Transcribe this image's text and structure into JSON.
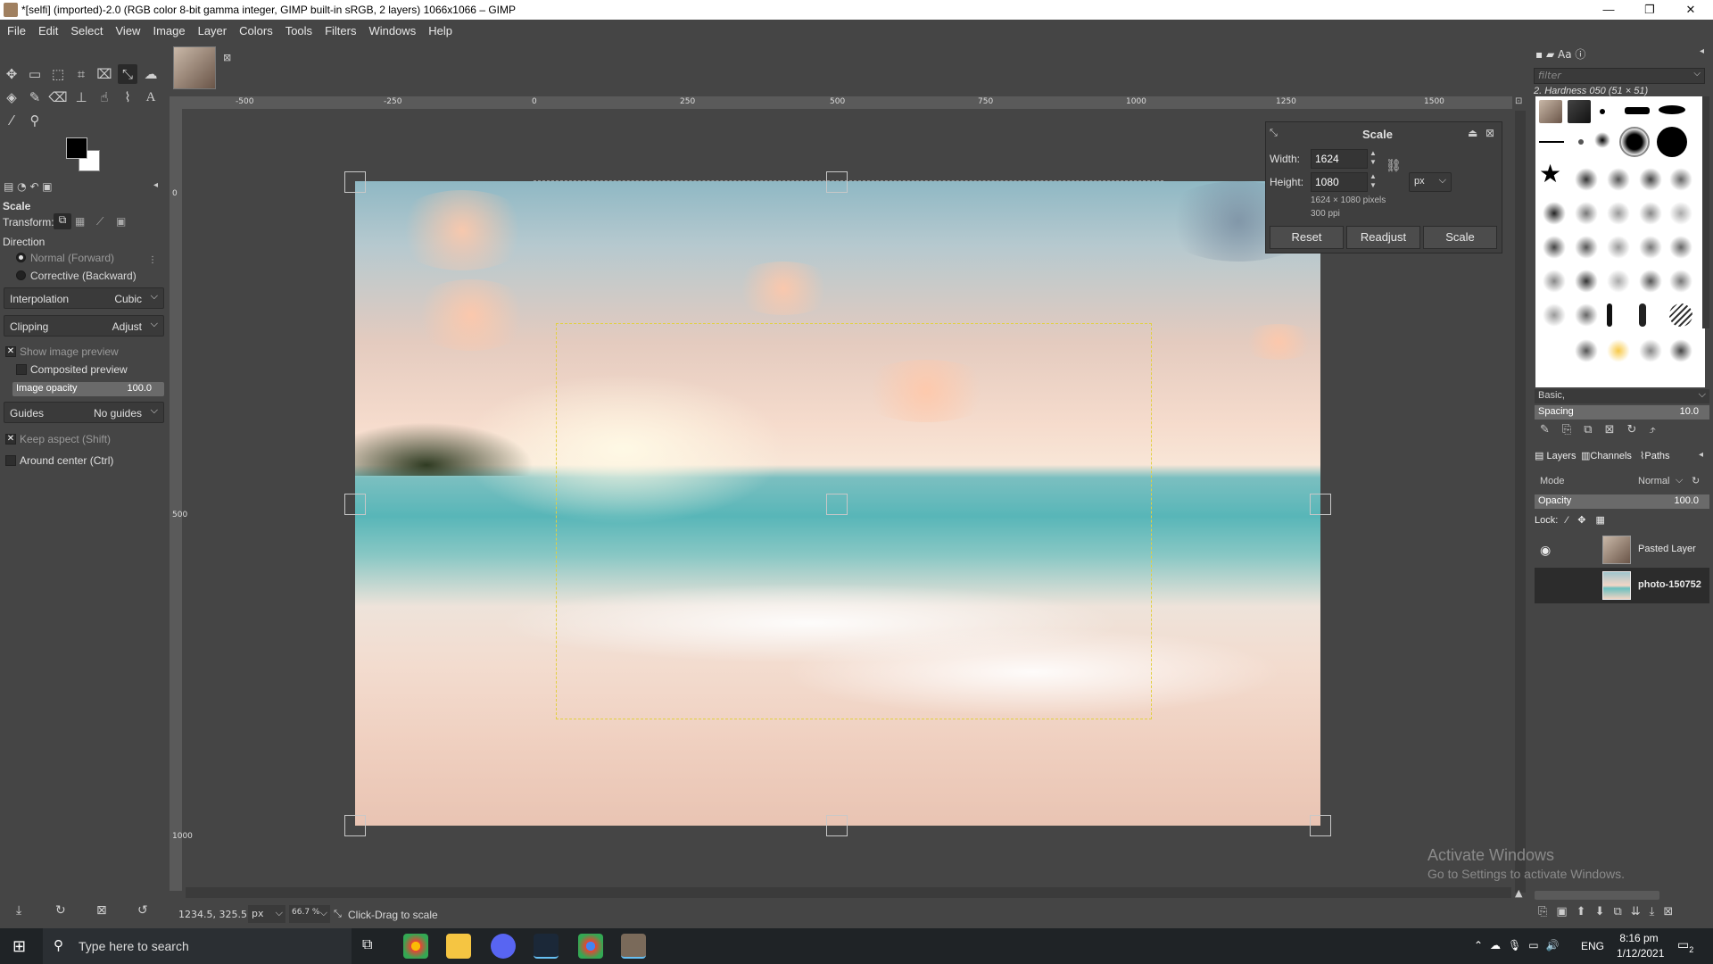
{
  "window": {
    "title": "*[selfi] (imported)-2.0 (RGB color 8-bit gamma integer, GIMP built-in sRGB, 2 layers) 1066x1066 – GIMP",
    "minimize": "—",
    "maximize": "❐",
    "close": "✕"
  },
  "menu": [
    "File",
    "Edit",
    "Select",
    "View",
    "Image",
    "Layer",
    "Colors",
    "Tools",
    "Filters",
    "Windows",
    "Help"
  ],
  "tool_options": {
    "title": "Scale",
    "transform_label": "Transform:",
    "direction_label": "Direction",
    "direction_normal": "Normal (Forward)",
    "direction_corrective": "Corrective (Backward)",
    "interpolation_label": "Interpolation",
    "interpolation_value": "Cubic",
    "clipping_label": "Clipping",
    "clipping_value": "Adjust",
    "show_preview": "Show image preview",
    "composited_preview": "Composited preview",
    "image_opacity_label": "Image opacity",
    "image_opacity_value": "100.0",
    "guides_label": "Guides",
    "guides_value": "No guides",
    "keep_aspect": "Keep aspect (Shift)",
    "around_center": "Around center (Ctrl)"
  },
  "rulers": {
    "h_ticks": [
      "-500",
      "-250",
      "0",
      "250",
      "500",
      "750",
      "1000",
      "1250",
      "1500"
    ],
    "v_ticks": [
      "0",
      "500",
      "1000"
    ]
  },
  "scale_dialog": {
    "title": "Scale",
    "width_label": "Width:",
    "width_value": "1624",
    "height_label": "Height:",
    "height_value": "1080",
    "unit": "px",
    "info_pixels": "1624 × 1080 pixels",
    "info_ppi": "300 ppi",
    "reset": "Reset",
    "readjust": "Readjust",
    "scale": "Scale"
  },
  "statusbar": {
    "coords": "1234.5, 325.5",
    "unit": "px",
    "zoom": "66.7 %",
    "message": "Click-Drag to scale"
  },
  "brushes": {
    "filter_placeholder": "filter",
    "current_brush": "2. Hardness 050 (51 × 51)",
    "preset": "Basic,",
    "spacing_label": "Spacing",
    "spacing_value": "10.0"
  },
  "layers_panel": {
    "tab_layers": "Layers",
    "tab_channels": "Channels",
    "tab_paths": "Paths",
    "mode_label": "Mode",
    "mode_value": "Normal",
    "opacity_label": "Opacity",
    "opacity_value": "100.0",
    "lock_label": "Lock:",
    "layers": [
      {
        "name": "Pasted Layer"
      },
      {
        "name": "photo-150752"
      }
    ]
  },
  "watermark": {
    "line1": "Activate Windows",
    "line2": "Go to Settings to activate Windows."
  },
  "taskbar": {
    "search_placeholder": "Type here to search",
    "lang": "ENG",
    "time": "8:16 pm",
    "date": "1/12/2021",
    "notifications": "2"
  }
}
